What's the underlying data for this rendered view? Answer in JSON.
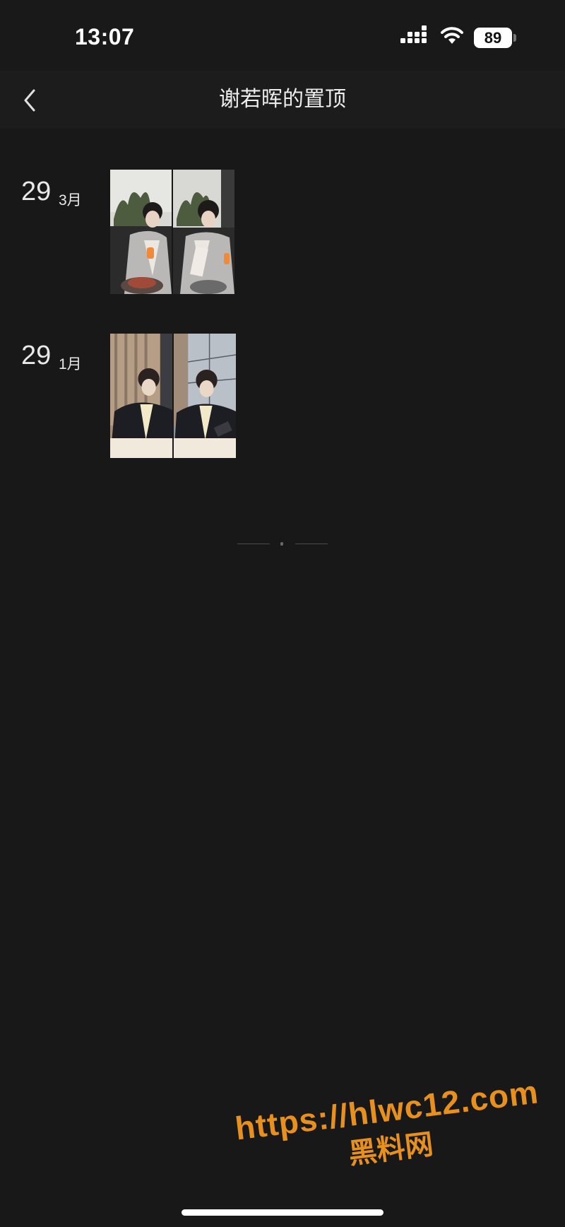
{
  "status_bar": {
    "time": "13:07",
    "battery": "89",
    "icons": [
      "signal-icon",
      "wifi-icon",
      "battery-icon"
    ]
  },
  "nav": {
    "back_icon": "chevron-left-icon",
    "title": "谢若晖的置顶"
  },
  "entries": [
    {
      "day": "29",
      "month": "3月",
      "thumbnail_count": 2
    },
    {
      "day": "29",
      "month": "1月",
      "thumbnail_count": 2
    }
  ],
  "watermark": {
    "url": "https://hlwc12.com",
    "name": "黑料网"
  },
  "colors": {
    "background": "#181818",
    "nav_background": "#1c1c1c",
    "text": "#e6e6e6",
    "watermark": "#e8901e"
  }
}
